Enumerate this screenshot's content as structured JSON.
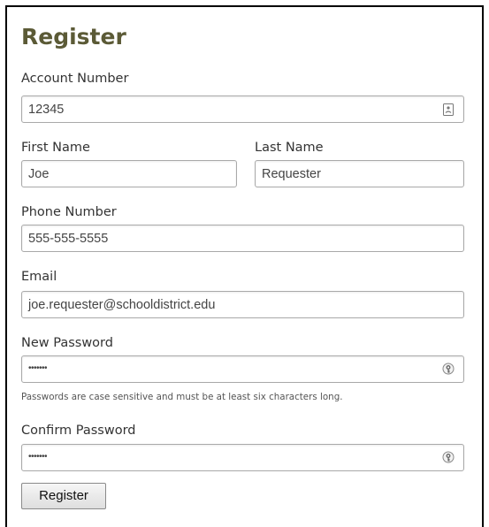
{
  "form": {
    "title": "Register",
    "account_number": {
      "label": "Account Number",
      "value": "12345",
      "icon": "contact-card-icon"
    },
    "first_name": {
      "label": "First Name",
      "value": "Joe"
    },
    "last_name": {
      "label": "Last Name",
      "value": "Requester"
    },
    "phone_number": {
      "label": "Phone Number",
      "value": "555-555-5555"
    },
    "email": {
      "label": "Email",
      "value": "joe.requester@schooldistrict.edu"
    },
    "new_password": {
      "label": "New Password",
      "value": "•••••••",
      "icon": "password-key-icon",
      "hint": "Passwords are case sensitive and must be at least six characters long."
    },
    "confirm_password": {
      "label": "Confirm Password",
      "value": "•••••••",
      "icon": "password-key-icon"
    },
    "submit_label": "Register"
  },
  "colors": {
    "heading": "#5b5a36",
    "field_border": "#a9a9a9"
  }
}
